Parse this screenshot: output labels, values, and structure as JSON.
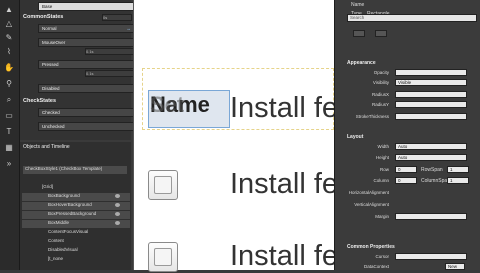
{
  "states": {
    "base": "Base",
    "common_group": "CommonStates",
    "common": [
      "Normal",
      "MouseOver",
      "Pressed",
      "Disabled"
    ],
    "check_group": "CheckStates",
    "check": [
      "Checked",
      "Unchecked"
    ],
    "transition": "0s",
    "transition2": "0.1s"
  },
  "objects": {
    "title": "Objects and Timeline",
    "breadcrumb": "CheckBoxStyle1 (CheckBox Template)",
    "items": [
      "[Grid]",
      "BoxBackground",
      "BoxHoverBackground",
      "BoxPressedBackground",
      "BoxMiddle",
      "ContentFocusVisual",
      "Content",
      "DisabledVisual",
      "[t_none"
    ]
  },
  "canvas": {
    "checkbox_selected": "Name",
    "checkbox_overlap": "Set",
    "label": "Install fe",
    "label_full": "Install features"
  },
  "props": {
    "name_label": "Name",
    "type_label": "Type",
    "type_value": "Rectangle",
    "search_placeholder": "Search",
    "appearance": "Appearance",
    "opacity": "Opacity",
    "visibility": "Visibility",
    "visibility_val": "Visible",
    "radiusx": "RadiusX",
    "radiusy": "RadiusY",
    "stroke_thickness": "StrokeThickness",
    "layout": "Layout",
    "width": "Width",
    "width_val": "Auto",
    "height": "Height",
    "height_val": "Auto",
    "row": "Row",
    "row_val": "0",
    "rowspan": "RowSpan",
    "rowspan_val": "1",
    "column": "Column",
    "column_val": "0",
    "columnspan": "ColumnSpan",
    "columnspan_val": "1",
    "h_align": "HorizontalAlignment",
    "v_align": "VerticalAlignment",
    "margin": "Margin",
    "common": "Common Properties",
    "cursor": "Cursor",
    "datacontext": "DataContext",
    "new": "New"
  }
}
